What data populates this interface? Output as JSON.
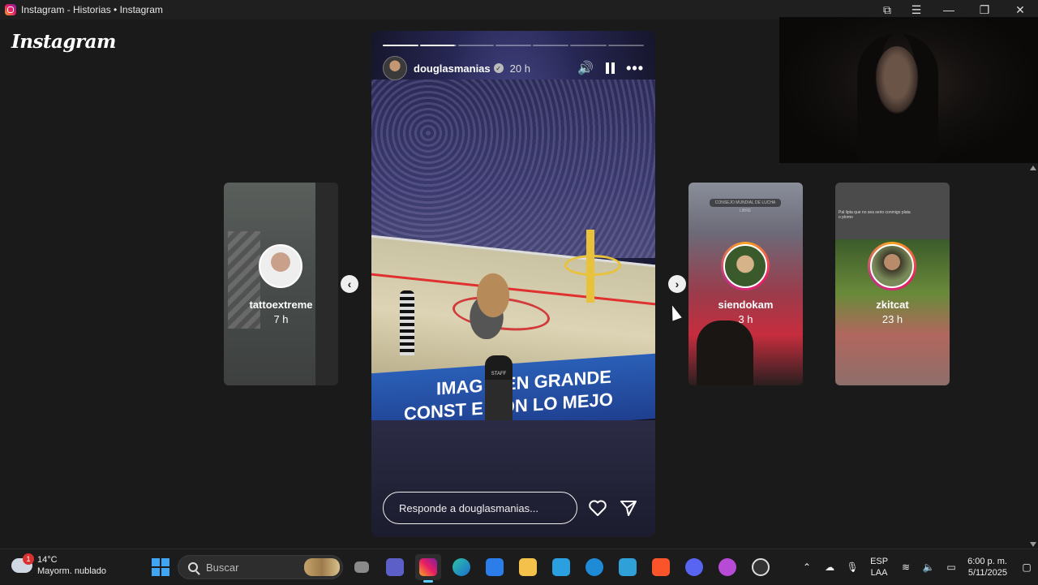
{
  "window": {
    "title": "Instagram - Historias • Instagram"
  },
  "page": {
    "logo": "Instagram"
  },
  "main_story": {
    "username": "douglasmanias",
    "time": "20 h",
    "progress": {
      "segments": 7,
      "completed": 1,
      "active_index": 1
    },
    "banner_line1": "IMAG  A EN GRANDE",
    "banner_line2": "CONST    E CON LO MEJO",
    "staff_label": "STAFF",
    "reply_placeholder": "Responde a douglasmanias..."
  },
  "side_stories": [
    {
      "username": "tattoextreme",
      "time": "7 h"
    },
    {
      "username": "siendokam",
      "time": "3 h",
      "banner": "CONSEJO MUNDIAL DE LUCHA LIBRE"
    },
    {
      "username": "zkitcat",
      "time": "23 h",
      "caption": "Pal lipta que no sea serio conmigo plata o plomo"
    }
  ],
  "taskbar": {
    "weather_temp": "14°C",
    "weather_desc": "Mayorm. nublado",
    "weather_badge": "1",
    "search_placeholder": "Buscar",
    "lang_line1": "ESP",
    "lang_line2": "LAA",
    "time": "6:00 p. m.",
    "date": "5/11/2025"
  },
  "icons": {
    "minimize": "—",
    "restore": "❐",
    "close": "✕",
    "extensions": "⧉",
    "menu": "☰",
    "volume": "🔊",
    "more": "•••",
    "heart": "♡",
    "send": "➢",
    "prev": "‹",
    "next": "›",
    "verified": "✓"
  }
}
